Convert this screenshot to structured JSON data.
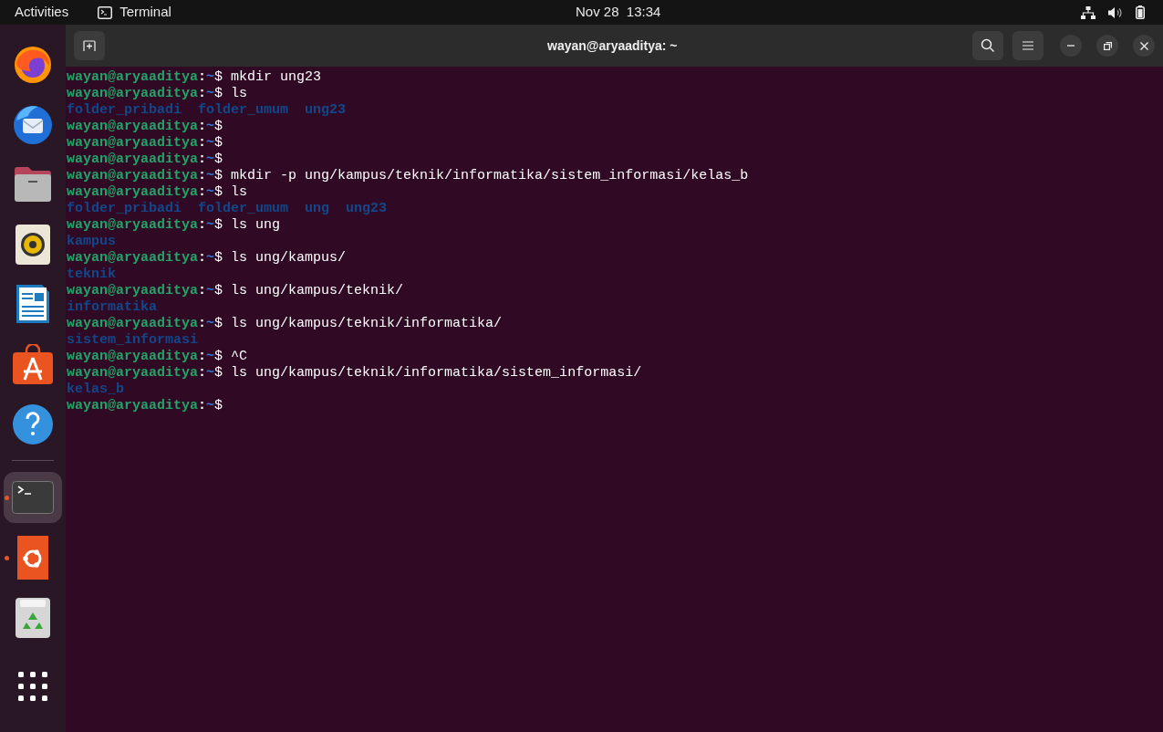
{
  "top_bar": {
    "activities": "Activities",
    "app_menu": "Terminal",
    "clock": "Nov 28  13:34"
  },
  "dock": {
    "items": [
      {
        "kind": "browser",
        "running": false,
        "selected": false
      },
      {
        "kind": "mail",
        "running": false,
        "selected": false
      },
      {
        "kind": "files",
        "running": false,
        "selected": false
      },
      {
        "kind": "music",
        "running": false,
        "selected": false
      },
      {
        "kind": "writer",
        "running": false,
        "selected": false
      },
      {
        "kind": "store",
        "running": false,
        "selected": false
      },
      {
        "kind": "help",
        "running": false,
        "selected": false
      },
      {
        "kind": "terminal",
        "running": true,
        "selected": true
      },
      {
        "kind": "ubuntu",
        "running": true,
        "selected": false
      },
      {
        "kind": "trash",
        "running": false,
        "selected": false
      },
      {
        "kind": "apps",
        "running": false,
        "selected": false
      }
    ]
  },
  "window": {
    "title": "wayan@aryaaditya: ~"
  },
  "terminal": {
    "lines": [
      {
        "kind": "prompt",
        "user": "wayan@aryaaditya",
        "sep": ":",
        "path": "~",
        "symbol": "$",
        "command": "mkdir ung23"
      },
      {
        "kind": "prompt",
        "user": "wayan@aryaaditya",
        "sep": ":",
        "path": "~",
        "symbol": "$",
        "command": "ls"
      },
      {
        "kind": "output",
        "text": "folder_pribadi  folder_umum  ung23"
      },
      {
        "kind": "prompt",
        "user": "wayan@aryaaditya",
        "sep": ":",
        "path": "~",
        "symbol": "$"
      },
      {
        "kind": "prompt",
        "user": "wayan@aryaaditya",
        "sep": ":",
        "path": "~",
        "symbol": "$"
      },
      {
        "kind": "prompt",
        "user": "wayan@aryaaditya",
        "sep": ":",
        "path": "~",
        "symbol": "$"
      },
      {
        "kind": "prompt",
        "user": "wayan@aryaaditya",
        "sep": ":",
        "path": "~",
        "symbol": "$",
        "command": "mkdir -p ung/kampus/teknik/informatika/sistem_informasi/kelas_b"
      },
      {
        "kind": "prompt",
        "user": "wayan@aryaaditya",
        "sep": ":",
        "path": "~",
        "symbol": "$",
        "command": "ls"
      },
      {
        "kind": "output",
        "text": "folder_pribadi  folder_umum  ung  ung23"
      },
      {
        "kind": "prompt",
        "user": "wayan@aryaaditya",
        "sep": ":",
        "path": "~",
        "symbol": "$",
        "command": "ls ung"
      },
      {
        "kind": "output",
        "text": "kampus"
      },
      {
        "kind": "prompt",
        "user": "wayan@aryaaditya",
        "sep": ":",
        "path": "~",
        "symbol": "$",
        "command": "ls ung/kampus/"
      },
      {
        "kind": "output",
        "text": "teknik"
      },
      {
        "kind": "prompt",
        "user": "wayan@aryaaditya",
        "sep": ":",
        "path": "~",
        "symbol": "$",
        "command": "ls ung/kampus/teknik/"
      },
      {
        "kind": "output",
        "text": "informatika"
      },
      {
        "kind": "prompt",
        "user": "wayan@aryaaditya",
        "sep": ":",
        "path": "~",
        "symbol": "$",
        "command": "ls ung/kampus/teknik/informatika/"
      },
      {
        "kind": "output",
        "text": "sistem_informasi"
      },
      {
        "kind": "prompt",
        "user": "wayan@aryaaditya",
        "sep": ":",
        "path": "~",
        "symbol": "$",
        "command": "^C"
      },
      {
        "kind": "prompt",
        "user": "wayan@aryaaditya",
        "sep": ":",
        "path": "~",
        "symbol": "$",
        "command": "ls ung/kampus/teknik/informatika/sistem_informasi/"
      },
      {
        "kind": "output",
        "text": "kelas_b"
      },
      {
        "kind": "prompt",
        "user": "wayan@aryaaditya",
        "sep": ":",
        "path": "~",
        "symbol": "$"
      }
    ]
  }
}
